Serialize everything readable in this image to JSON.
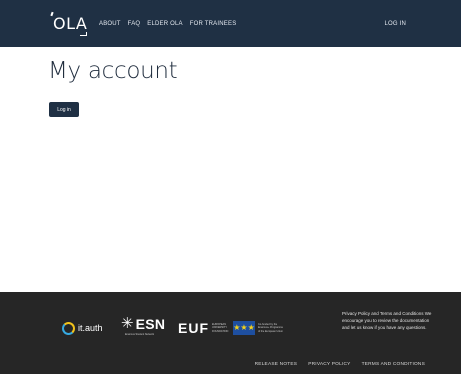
{
  "navbar": {
    "logo_text": "OLA",
    "links": [
      "ABOUT",
      "FAQ",
      "ELDER OLA",
      "FOR TRAINEES"
    ],
    "login_label": "LOG IN"
  },
  "main": {
    "title": "My account",
    "login_button_label": "Log in"
  },
  "footer": {
    "partners": {
      "itauth": "it.auth",
      "esn": "ESN",
      "esn_sub": "Erasmus Student Network",
      "euf": "EUF",
      "euf_sub_1": "EUROPEAN",
      "euf_sub_2": "UNIVERSITY",
      "euf_sub_3": "FOUNDATION",
      "eu_sub_1": "Co-funded by the",
      "eu_sub_2": "Erasmus+ Programme",
      "eu_sub_3": "of the European Union",
      "eu_stars": "★★★"
    },
    "note": "Privacy Policy and Terms and Conditions We encourage you to review the documentation and let us know if you have any questions.",
    "links": [
      "RELEASE NOTES",
      "PRIVACY POLICY",
      "TERMS AND CONDITIONS"
    ]
  },
  "colors": {
    "navbar_bg": "#1f3044",
    "footer_bg": "#262626",
    "page_bg": "#ffffff",
    "title_text": "#1f2c3d",
    "button_bg": "#1f3044"
  },
  "icons": {
    "logo": "ola-logo",
    "itauth": "itauth-ring-icon",
    "esn": "esn-star-icon",
    "eu": "eu-flag-icon"
  }
}
